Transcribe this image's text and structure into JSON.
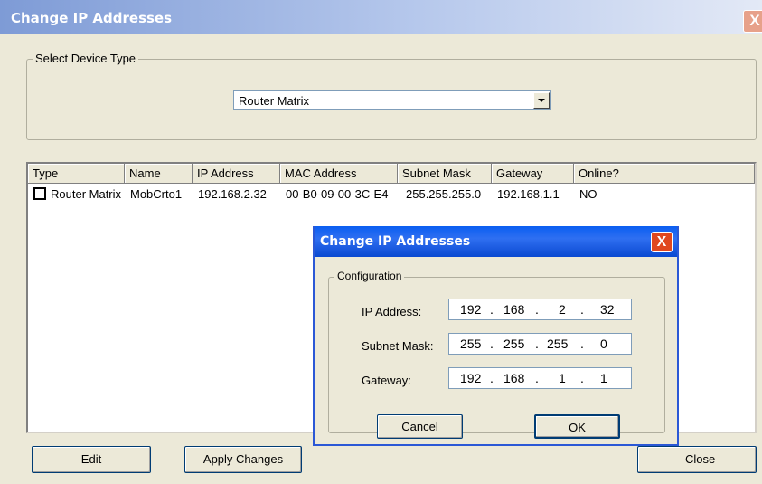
{
  "window": {
    "title": "Change IP Addresses",
    "close_symbol": "X"
  },
  "device_type": {
    "legend": "Select Device Type",
    "selected": "Router Matrix"
  },
  "list": {
    "columns": [
      "Type",
      "Name",
      "IP Address",
      "MAC Address",
      "Subnet Mask",
      "Gateway",
      "Online?"
    ],
    "rows": [
      {
        "checked": false,
        "type": "Router Matrix",
        "name": "MobCrto1",
        "ip": "192.168.2.32",
        "mac": "00-B0-09-00-3C-E4",
        "subnet": "255.255.255.0",
        "gateway": "192.168.1.1",
        "online": "NO"
      }
    ]
  },
  "buttons": {
    "edit": "Edit",
    "apply": "Apply Changes",
    "close": "Close"
  },
  "dialog": {
    "title": "Change IP Addresses",
    "close_symbol": "X",
    "legend": "Configuration",
    "ip_label": "IP Address:",
    "ip": [
      "192",
      "168",
      "2",
      "32"
    ],
    "subnet_label": "Subnet Mask:",
    "subnet": [
      "255",
      "255",
      "255",
      "0"
    ],
    "gateway_label": "Gateway:",
    "gateway": [
      "192",
      "168",
      "1",
      "1"
    ],
    "cancel": "Cancel",
    "ok": "OK"
  }
}
